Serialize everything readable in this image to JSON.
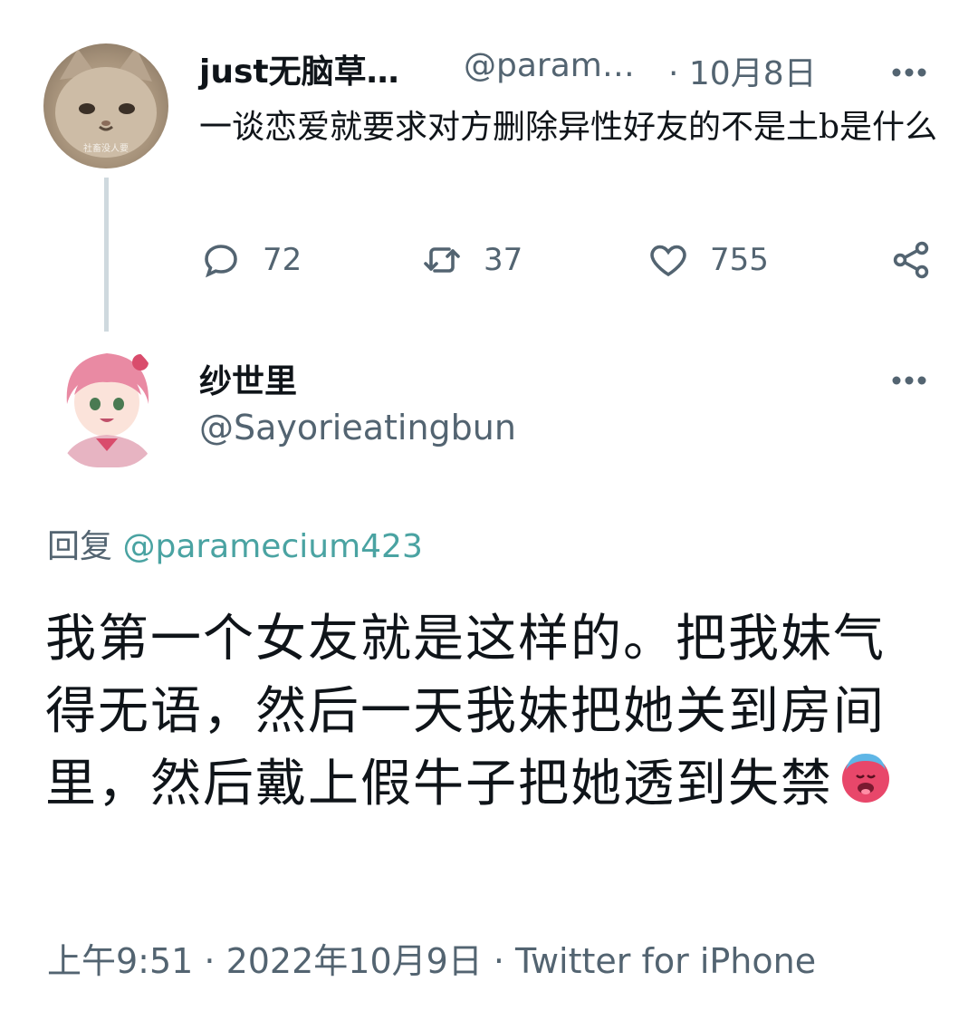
{
  "parent_tweet": {
    "avatar_caption": "社畜没人要",
    "display_name": "just无脑草…",
    "handle": "@param…",
    "date": "· 10月8日",
    "more_icon": "more-horizontal-icon",
    "text": "一谈恋爱就要求对方删除异性好友的不是土b是什么",
    "actions": {
      "reply_count": "72",
      "retweet_count": "37",
      "like_count": "755"
    }
  },
  "reply_tweet": {
    "display_name": "纱世里",
    "handle": "@Sayorieatingbun",
    "reply_prefix": "回复",
    "reply_mention": "@paramecium423",
    "text": "我第一个女友就是这样的。把我妹气得无语，然后一天我妹把她关到房间里，然后戴上假牛子把她透到失禁",
    "emoji": "hot-face-emoji",
    "timestamp": "上午9:51 · 2022年10月9日 · Twitter for iPhone"
  },
  "colors": {
    "text_primary": "#0f1419",
    "text_secondary": "#536471",
    "mention": "#4aa3a2",
    "thread_line": "#cfd9de"
  }
}
